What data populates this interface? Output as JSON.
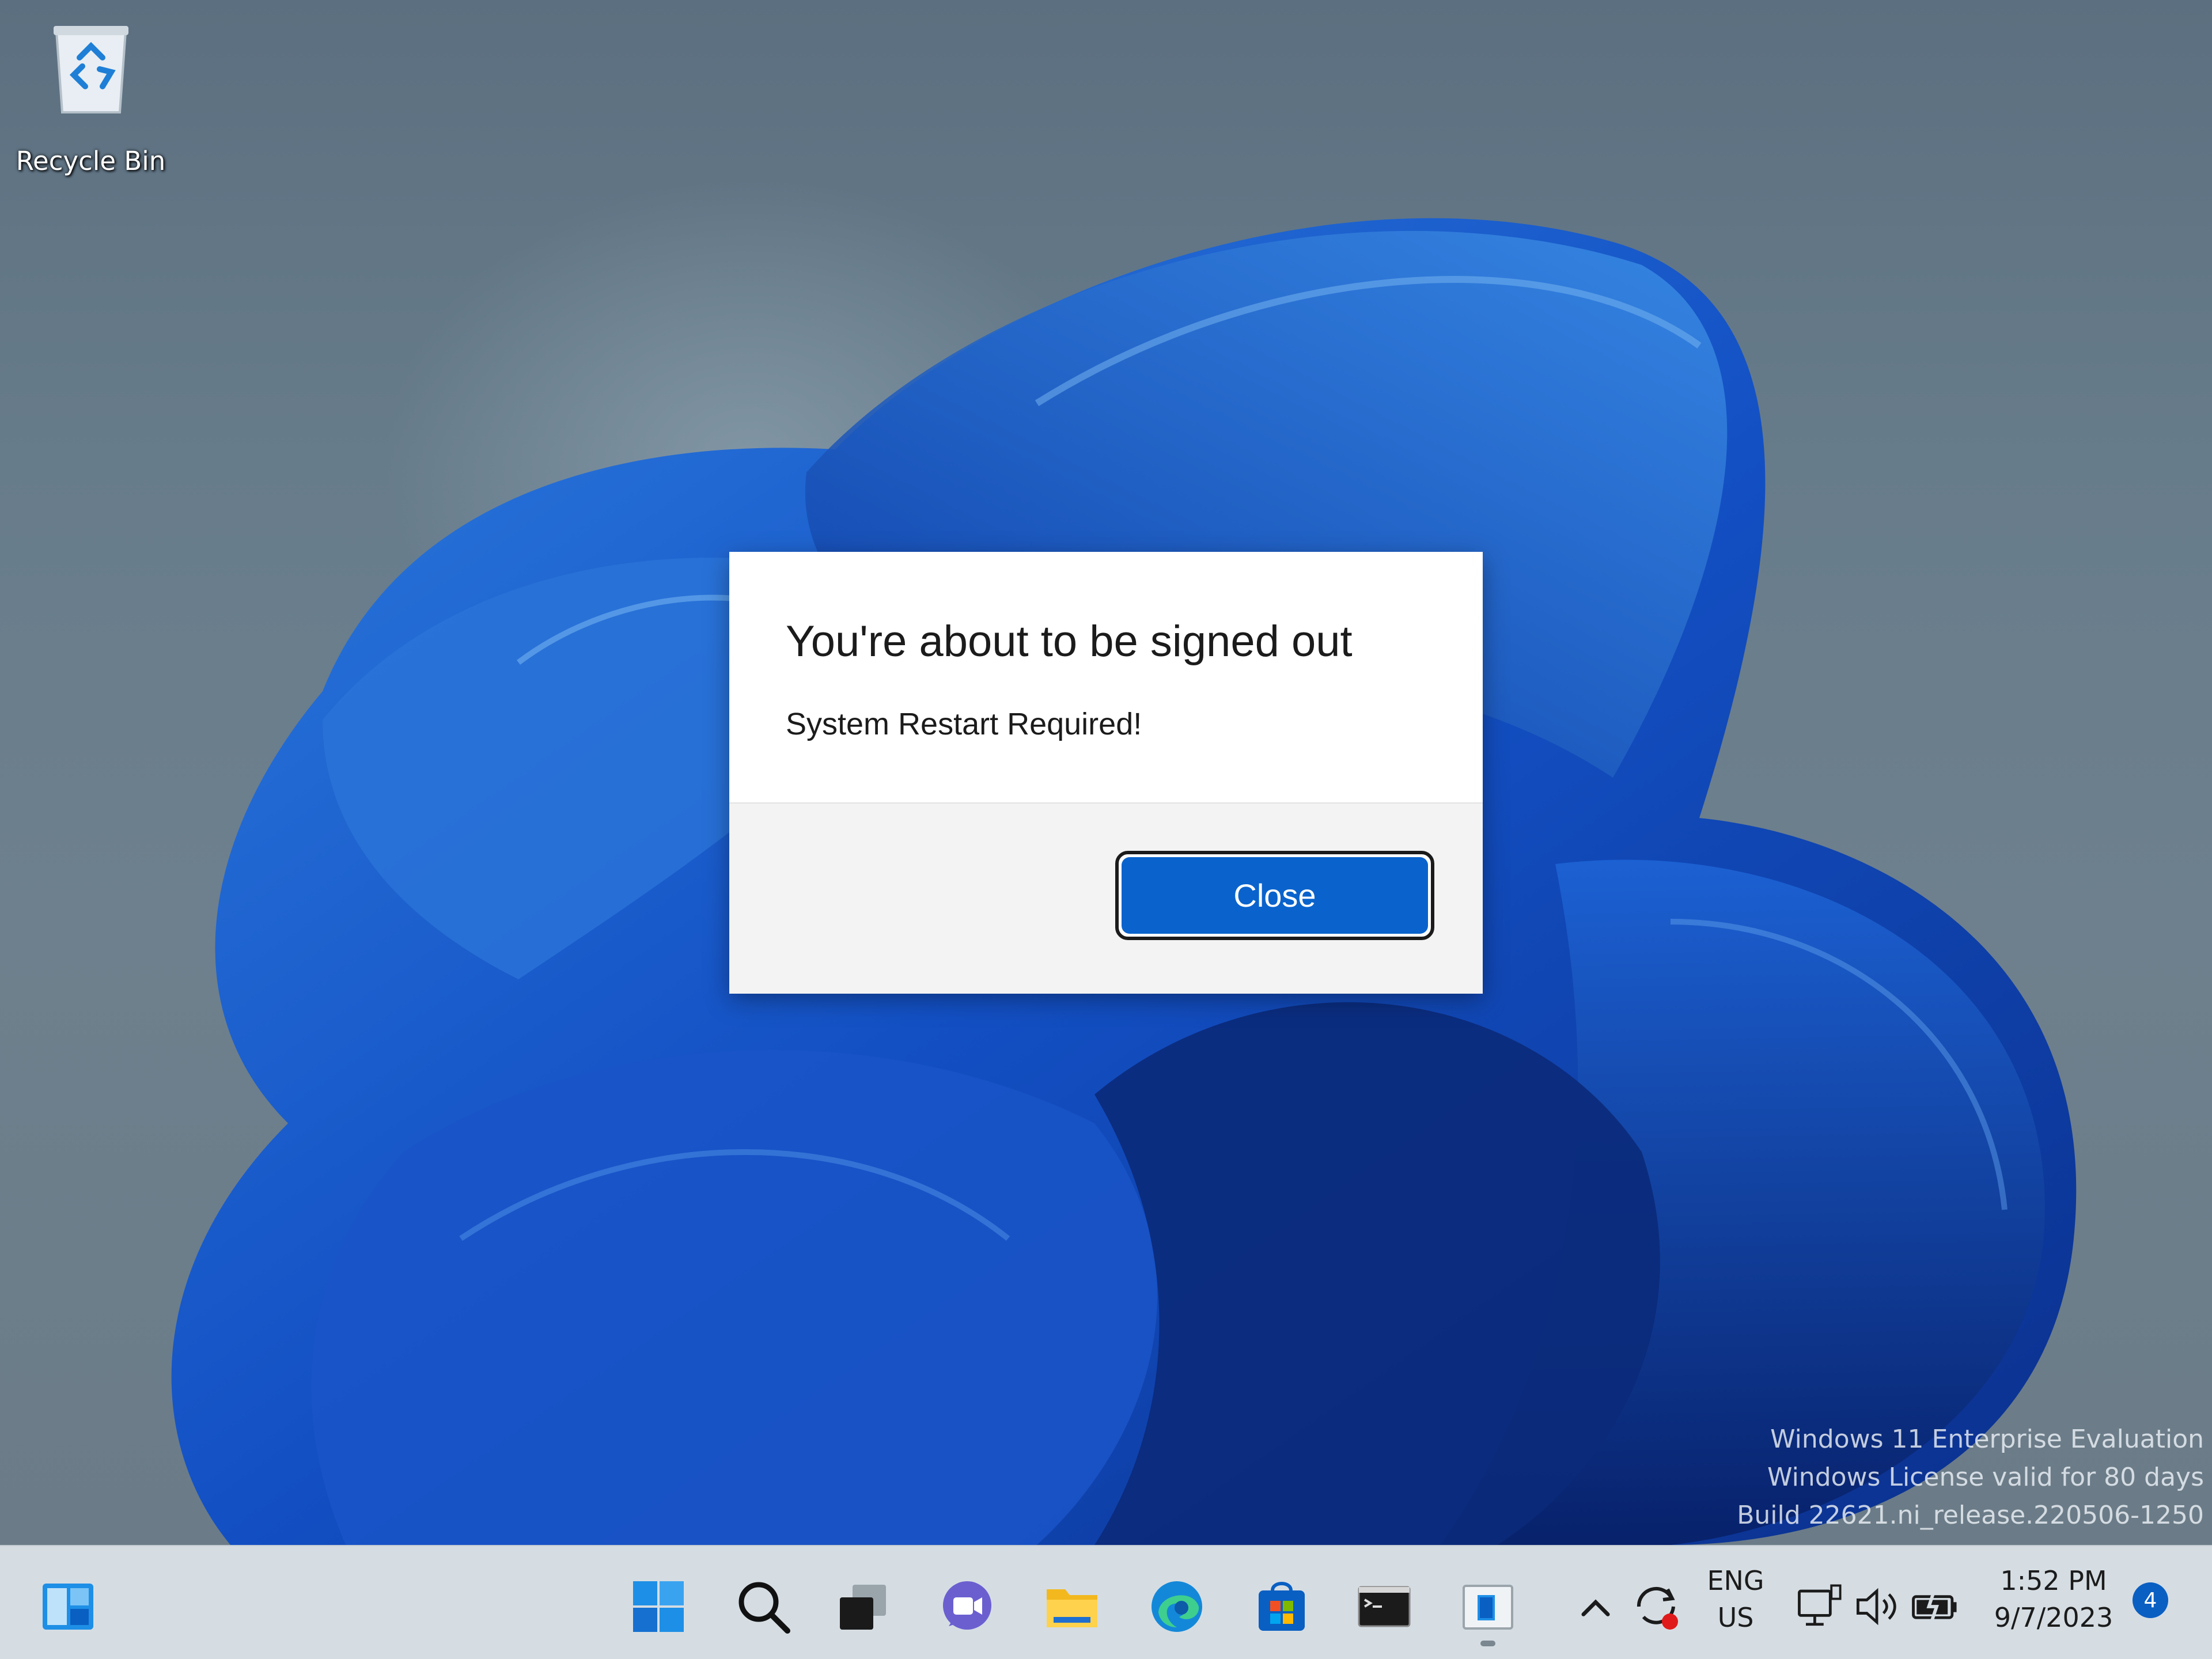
{
  "desktop": {
    "icons": [
      {
        "label": "Recycle Bin",
        "icon": "recycle-bin-icon"
      }
    ],
    "watermark": {
      "line1": "Windows 11 Enterprise Evaluation",
      "line2": "Windows License valid for 80 days",
      "line3": "Build 22621.ni_release.220506-1250"
    }
  },
  "dialog": {
    "title": "You're about to be signed out",
    "message": "System Restart Required!",
    "close_label": "Close",
    "accent_color": "#0a63cc"
  },
  "taskbar": {
    "left_item": "widgets-icon",
    "pinned": [
      "start-icon",
      "search-icon",
      "task-view-icon",
      "chat-icon",
      "file-explorer-icon",
      "edge-icon",
      "store-icon",
      "terminal-icon",
      "app-window-icon"
    ],
    "tray": {
      "language_line1": "ENG",
      "language_line2": "US",
      "time": "1:52 PM",
      "date": "9/7/2023",
      "notification_count": "4",
      "icons": [
        "chevron-up-icon",
        "sync-icon",
        "network-icon",
        "volume-icon",
        "battery-icon"
      ]
    }
  }
}
